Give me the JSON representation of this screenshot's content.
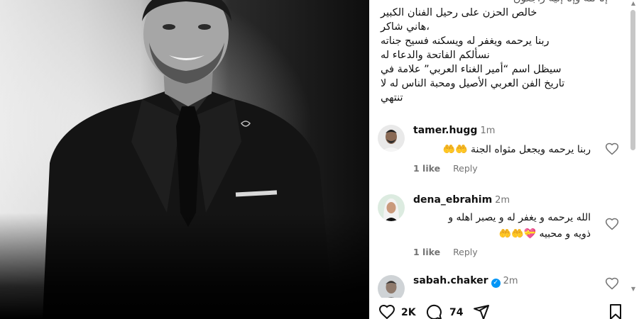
{
  "post": {
    "caption_top_fragment": "إنا لله وإنا إليه راجعون",
    "caption_lines": [
      "خالص الحزن على رحيل الفنان الكبير",
      "،هاني شاكر",
      "ربنا يرحمه ويغفر له ويسكنه فسيح جناته",
      "نسألكم الفاتحة والدعاء له",
      "سيظل اسم “أمير الغناء العربي” علامة في",
      "تاريخ الفن العربي الأصيل ومحبة الناس له لا",
      "تنتهي"
    ]
  },
  "comments": [
    {
      "username": "tamer.hugg",
      "time": "1m",
      "verified": false,
      "text": "ربنا يرحمه ويجعل مثواه الجنة 🤲🤲",
      "likes": "1 like",
      "reply": "Reply",
      "avatar_icon": "avatar-photo-bearded-man"
    },
    {
      "username": "dena_ebrahim",
      "time": "2m",
      "verified": false,
      "text_line1": "الله يرحمه و يغفر له و يصبر اهله و",
      "text_line2": "ذويه و محبيه 💝🤲🤲",
      "likes": "1 like",
      "reply": "Reply",
      "avatar_icon": "avatar-photo-woman-hijab"
    },
    {
      "username": "sabah.chaker",
      "time": "2m",
      "verified": true,
      "avatar_icon": "avatar-photo-man"
    }
  ],
  "actions": {
    "like_count": "2K",
    "comment_count": "74",
    "icons": [
      "heart-icon",
      "comment-icon",
      "share-icon",
      "bookmark-icon"
    ]
  },
  "colors": {
    "verified_badge": "#0095f6",
    "secondary_text": "#737373",
    "scroll_thumb": "#c7c7c7"
  }
}
